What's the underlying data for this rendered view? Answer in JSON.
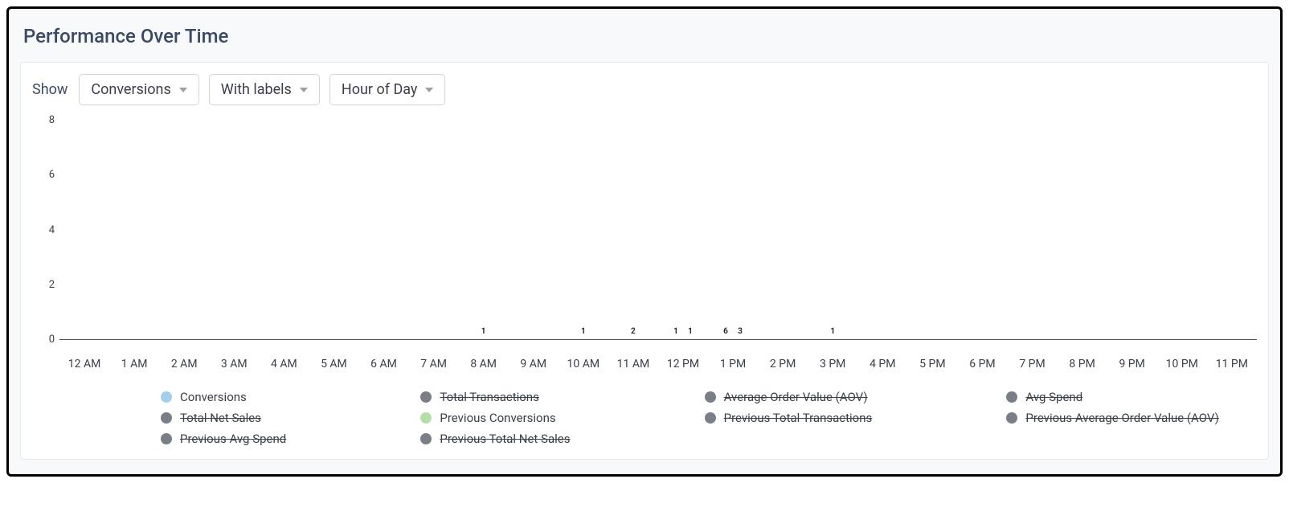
{
  "title": "Performance Over Time",
  "controls": {
    "show_label": "Show",
    "metric": "Conversions",
    "labels": "With labels",
    "granularity": "Hour of Day"
  },
  "legend": [
    {
      "name": "Conversions",
      "color": "#a4cdec",
      "active": true
    },
    {
      "name": "Total Transactions",
      "color": "#7a7f87",
      "active": false
    },
    {
      "name": "Average Order Value (AOV)",
      "color": "#7a7f87",
      "active": false
    },
    {
      "name": "Avg Spend",
      "color": "#7a7f87",
      "active": false
    },
    {
      "name": "Total Net Sales",
      "color": "#7a7f87",
      "active": false
    },
    {
      "name": "Previous Conversions",
      "color": "#b5dfa8",
      "active": true
    },
    {
      "name": "Previous Total Transactions",
      "color": "#7a7f87",
      "active": false
    },
    {
      "name": "Previous Average Order Value (AOV)",
      "color": "#7a7f87",
      "active": false
    },
    {
      "name": "Previous Avg Spend",
      "color": "#7a7f87",
      "active": false
    },
    {
      "name": "Previous Total Net Sales",
      "color": "#7a7f87",
      "active": false
    }
  ],
  "chart_data": {
    "type": "bar",
    "title": "Performance Over Time",
    "xlabel": "",
    "ylabel": "",
    "ylim": [
      0,
      8
    ],
    "yticks": [
      0,
      2,
      4,
      6,
      8
    ],
    "categories": [
      "12 AM",
      "1 AM",
      "2 AM",
      "3 AM",
      "4 AM",
      "5 AM",
      "6 AM",
      "7 AM",
      "8 AM",
      "9 AM",
      "10 AM",
      "11 AM",
      "12 PM",
      "1 PM",
      "2 PM",
      "3 PM",
      "4 PM",
      "5 PM",
      "6 PM",
      "7 PM",
      "8 PM",
      "9 PM",
      "10 PM",
      "11 PM"
    ],
    "series": [
      {
        "name": "Conversions",
        "color": "#a4cdec",
        "values": [
          null,
          null,
          null,
          null,
          null,
          null,
          null,
          null,
          null,
          null,
          null,
          null,
          1,
          6,
          null,
          1,
          null,
          null,
          null,
          null,
          null,
          null,
          null,
          null
        ]
      },
      {
        "name": "Previous Conversions",
        "color": "#b5dfa8",
        "values": [
          null,
          null,
          null,
          null,
          null,
          null,
          null,
          null,
          1,
          null,
          1,
          2,
          1,
          3,
          null,
          null,
          null,
          null,
          null,
          null,
          null,
          null,
          null,
          null
        ]
      }
    ],
    "show_data_labels": true
  }
}
